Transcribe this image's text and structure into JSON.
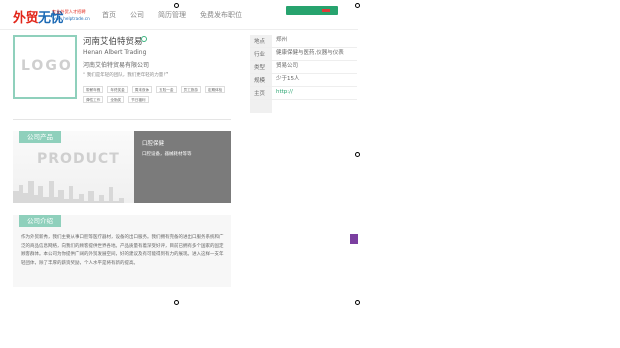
{
  "header": {
    "logo_red": "外贸",
    "logo_blue": "无忧",
    "logo_tagline": "专业外贸人才招聘",
    "logo_url": "www.helptrade.cn",
    "nav": [
      "首页",
      "公司",
      "简历管理",
      "免费发布职位"
    ]
  },
  "company": {
    "logo_text": "LOGO",
    "name": "河南艾伯特贸易",
    "english_name": "Henan Albert Trading",
    "full_name": "河南艾伯特贸易有限公司",
    "quote": "我们是年轻的团队，我们更年轻的力量！",
    "tags": [
      "带薪年假",
      "年终奖金",
      "周末双休",
      "五险一金",
      "员工旅游",
      "定期体检",
      "弹性工作",
      "全勤奖",
      "节日福利"
    ]
  },
  "info": [
    {
      "label": "地点",
      "value": "郑州"
    },
    {
      "label": "行业",
      "value": "健康保健与医药,仪器与仪表"
    },
    {
      "label": "类型",
      "value": "贸易公司"
    },
    {
      "label": "规模",
      "value": "少于15人"
    },
    {
      "label": "主页",
      "value": "http://"
    }
  ],
  "products": {
    "title": "公司产品",
    "placeholder": "PRODUCT",
    "item_title": "口腔保健",
    "item_desc": "口腔设备，器械耗材等等"
  },
  "about": {
    "title": "公司介绍",
    "text": "作为外贸新秀，我们主要从事口腔等医疗器材，设备的出口服务。我们拥有完备的进出口服务系统和广泛的商品信息网络，向我们的顾客提供世界各地。产品质量有着深受好评，目前已拥有多个国家的固定顾客群体。本公司为你提供广阔的外贸发展空间，好的建议及有可能得到有力的展现。进入这样一支年轻团体，除了丰厚的薪资奖励，个人水平是将有新的提高。"
  }
}
